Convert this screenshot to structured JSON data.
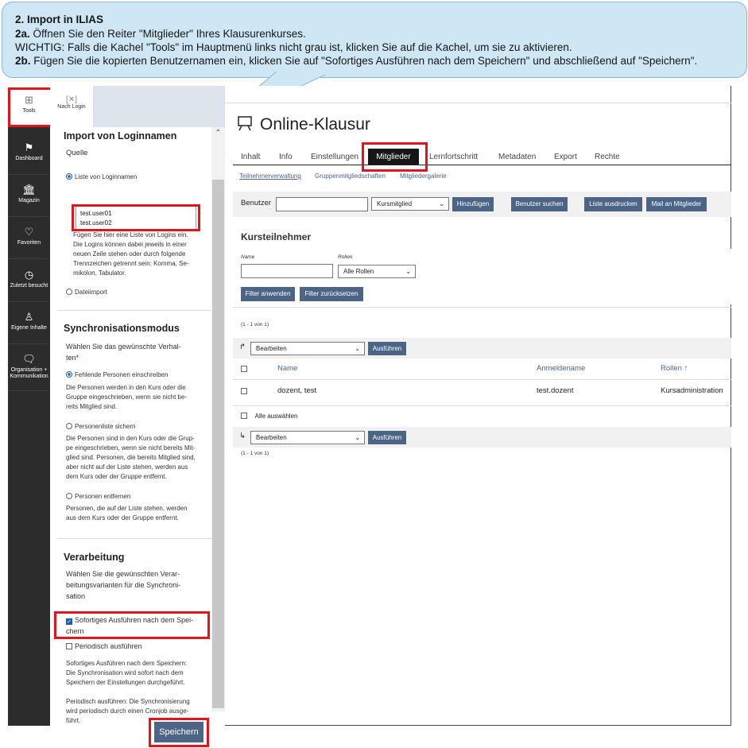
{
  "callout": {
    "line1": "2. Import in ILIAS",
    "line2_bold": "2a.",
    "line2": " Öffnen Sie den Reiter \"Mitglieder\" Ihres Klausurenkurses.",
    "line3": "WICHTIG: Falls die Kachel \"Tools\" im Hauptmenü links nicht grau ist, klicken Sie auf die Kachel, um sie zu aktivieren.",
    "line4_bold": "2b.",
    "line4": " Fügen Sie die kopierten Benutzernamen ein, klicken Sie auf \"Sofortiges Ausführen nach dem Speichern\" und abschließend auf \"Speichern\"."
  },
  "mainbar": {
    "items": [
      {
        "label": "Tools",
        "icon": "grid-icon"
      },
      {
        "label": "Dashboard",
        "icon": "flag-icon"
      },
      {
        "label": "Magazin",
        "icon": "library-icon"
      },
      {
        "label": "Favoriten",
        "icon": "heart-icon"
      },
      {
        "label": "Zuletzt besucht",
        "icon": "clock-icon"
      },
      {
        "label": "Eigene Inhalte",
        "icon": "user-icon"
      },
      {
        "label": "Organisation + Kommunikation",
        "icon": "chat-icon"
      }
    ]
  },
  "slate": {
    "tab_label": "Nach Login",
    "heading_import": "Import von Loginnamen",
    "label_quelle": "Quelle",
    "radio_loginnamen": "Liste von Loginnamen",
    "logins_value": "test.user01\ntest.user02",
    "logins_help": "Fügen Sie hier eine Liste von Logins ein.\nDie Logins können dabei jeweils in einer\nneuen Zeile stehen oder durch folgende\nTrennzeichen getrennt sein: Komma, Se-\nmikolon, Tabulator.",
    "radio_dateiimport": "Dateiimport",
    "heading_sync": "Synchronisationsmodus",
    "sync_prompt": "Wählen Sie das gewünschte Verhal-\nten",
    "required_mark": "*",
    "radio_fehlende": "Fehlende Personen einschreiben",
    "help_fehlende": "Die Personen werden in den Kurs oder die\nGruppe eingeschrieben, wenn sie nicht be-\nreits Mitglied sind.",
    "radio_sichern": "Personenliste sichern",
    "help_sichern": "Die Personen sind in den Kurs oder die Grup-\npe eingeschrieben, wenn sie nicht bereits Mit-\nglied sind. Personen, die bereits Mitglied sind,\naber nicht auf der Liste stehen, werden aus\ndem Kurs oder der Gruppe entfernt.",
    "radio_entfernen": "Personen entfernen",
    "help_entfernen": "Personen, die auf der Liste stehen, werden\naus dem Kurs oder der Gruppe entfernt.",
    "heading_verarbeitung": "Verarbeitung",
    "verarbeitung_prompt": "Wählen Sie die gewünschten Verar-\nbeitungsvarianten für die Synchroni-\nsation",
    "check_sofort": "Sofortiges Ausführen nach dem Spei-\nchern",
    "check_periodisch": "Periodisch ausführen",
    "help_verarbeitung": "Sofortiges Ausführen nach dem Speichern:\nDie Synchronisation wird sofort nach dem\nSpeichern der Einstellungen durchgeführt.\n\nPeriodisch ausführen: Die Synchronisierung\nwird periodisch durch einen Cronjob ausge-\nführt.",
    "save_label": "Speichern"
  },
  "main": {
    "title": "Online-Klausur",
    "tabs": [
      "Inhalt",
      "Info",
      "Einstellungen",
      "Mitglieder",
      "Lernfortschritt",
      "Metadaten",
      "Export",
      "Rechte"
    ],
    "subtabs": [
      "Teilnehmerverwaltung",
      "Gruppenmitgliedschaften",
      "Mitgliedergalerie"
    ],
    "toolbar": {
      "benutzer_label": "Benutzer",
      "role_select": "Kursmitglied",
      "add_label": "Hinzufügen",
      "search_label": "Benutzer suchen",
      "print_label": "Liste ausdrucken",
      "mail_label": "Mail an Mitglieder"
    },
    "section_title": "Kursteilnehmer",
    "filter": {
      "name_label": "Name",
      "roles_label": "Rollen",
      "roles_value": "Alle Rollen",
      "apply_label": "Filter anwenden",
      "reset_label": "Filter zurücksetzen"
    },
    "count_top": "(1 - 1 von 1)",
    "action_select": "Bearbeiten",
    "execute_label": "Ausführen",
    "table": {
      "headers": [
        "Name",
        "Anmeldename",
        "Rollen"
      ],
      "sort_icon": "↑",
      "rows": [
        {
          "name": "dozent, test",
          "login": "test.dozent",
          "role": "Kursadministration"
        }
      ]
    },
    "select_all": "Alle auswählen",
    "count_bottom": "(1 - 1 von 1)"
  },
  "colors": {
    "accent": "#4c6586",
    "highlight": "#e3141b",
    "mainbar": "#2c2c2c",
    "callout": "#cfe6f4"
  }
}
